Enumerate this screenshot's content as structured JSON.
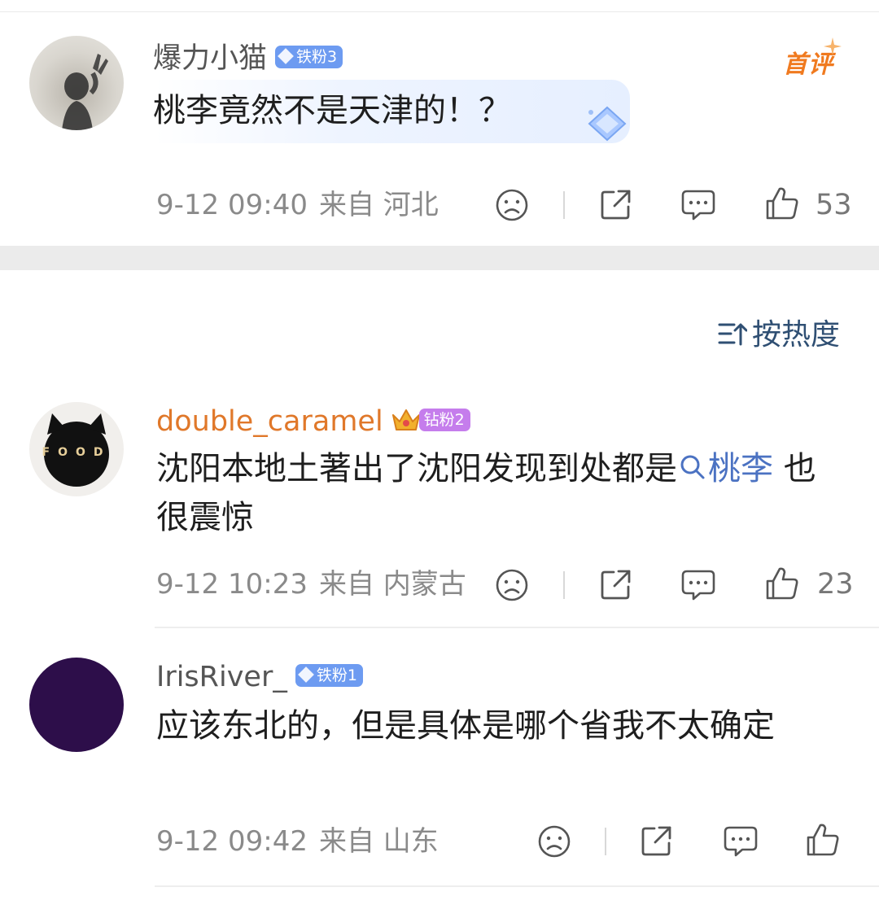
{
  "section_sort": {
    "label": "按热度"
  },
  "comments": [
    {
      "username": "爆力小猫",
      "badge": "铁粉3",
      "tag": "首评",
      "text": "桃李竟然不是天津的！？",
      "time": "9-12 09:40",
      "source": "来自 河北",
      "likes": "53"
    },
    {
      "username": "double_caramel",
      "badge": "钻粉2",
      "text_before": "沈阳本地土著出了沈阳发现到处都是",
      "mention": "桃李",
      "text_after": " 也很震惊",
      "time": "9-12 10:23",
      "source": "来自 内蒙古",
      "likes": "23"
    },
    {
      "username": "IrisRiver_",
      "badge": "铁粉1",
      "text": "应该东北的，但是具体是哪个省我不太确定",
      "time": "9-12 09:42",
      "source": "来自 山东",
      "likes": ""
    }
  ],
  "colors": {
    "username_vip": "#e0782a",
    "username_normal": "#555555",
    "mention": "#4b72c2",
    "iron_badge": "#6d9bf1",
    "diamond_badge": "#c57dec",
    "first_tag": "#f07a1f"
  },
  "icons": [
    "dislike-face-icon",
    "share-icon",
    "comment-icon",
    "like-thumb-icon",
    "search-icon",
    "sort-icon",
    "crown-icon",
    "gem-icon"
  ]
}
